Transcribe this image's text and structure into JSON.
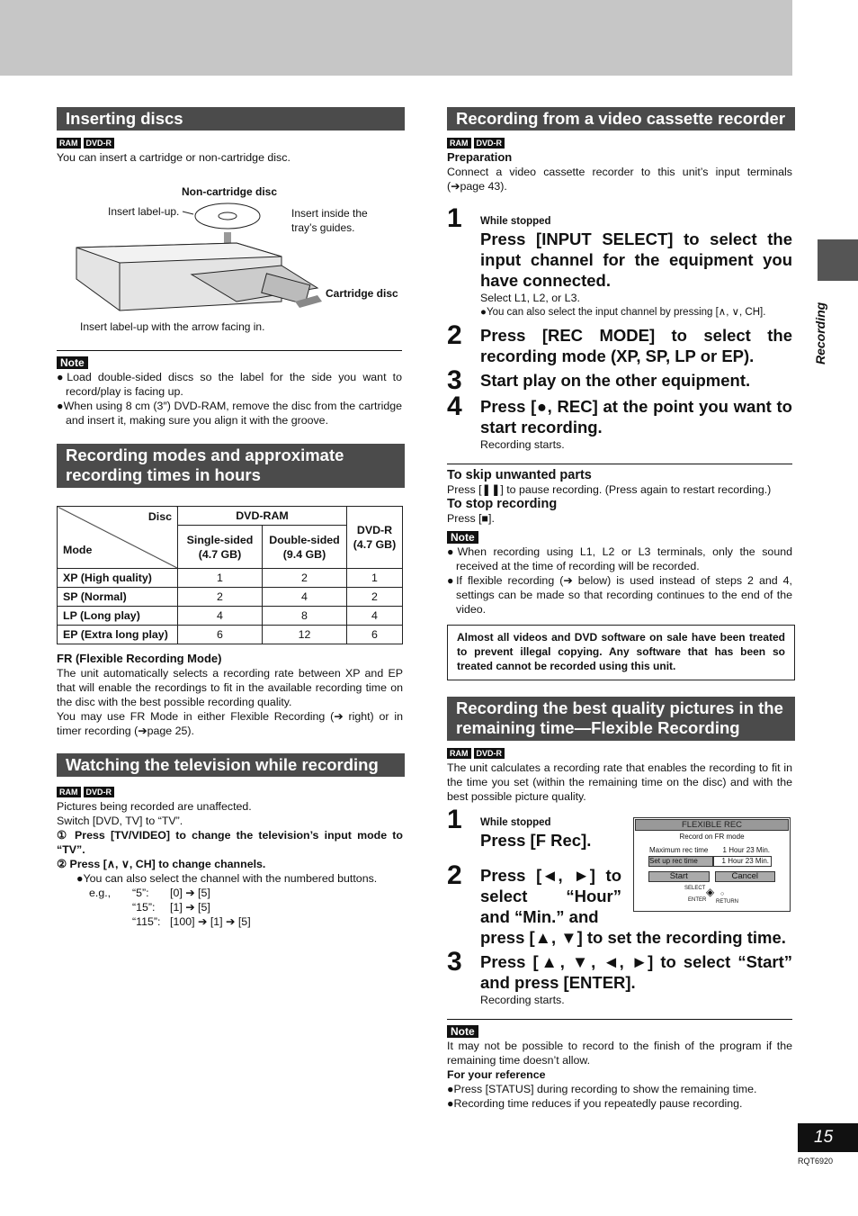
{
  "badges": {
    "ram": "RAM",
    "dvdr": "DVD-R"
  },
  "note_label": "Note",
  "inserting": {
    "title": "Inserting discs",
    "intro": "You can insert a cartridge or non-cartridge disc.",
    "fig": {
      "noncart": "Non-cartridge disc",
      "label_up": "Insert label-up.",
      "inside": "Insert inside the tray’s guides.",
      "cart": "Cartridge disc",
      "arrow": "Insert label-up with the arrow facing in."
    },
    "notes": [
      "Load double-sided discs so the label for the side you want to record/play is facing up.",
      "When using 8 cm (3″) DVD-RAM, remove the disc from the cartridge and insert it, making sure you align it with the groove."
    ]
  },
  "modes": {
    "title": "Recording modes and approximate recording times in hours",
    "table": {
      "disc": "Disc",
      "mode": "Mode",
      "dvdram": "DVD-RAM",
      "single": "Single-sided (4.7 GB)",
      "double": "Double-sided (9.4 GB)",
      "dvdr": "DVD-R (4.7 GB)",
      "rows": [
        {
          "m": "XP (High quality)",
          "a": "1",
          "b": "2",
          "c": "1"
        },
        {
          "m": "SP (Normal)",
          "a": "2",
          "b": "4",
          "c": "2"
        },
        {
          "m": "LP (Long play)",
          "a": "4",
          "b": "8",
          "c": "4"
        },
        {
          "m": "EP (Extra long play)",
          "a": "6",
          "b": "12",
          "c": "6"
        }
      ]
    },
    "fr_title": "FR (Flexible Recording Mode)",
    "fr_text": "The unit automatically selects a recording rate between XP and EP that will enable the recordings to fit in the available recording time on the disc with the best possible recording quality.",
    "fr_text2": "You may use FR Mode in either Flexible Recording (➔ right) or in timer recording (➔page 25)."
  },
  "watching": {
    "title": "Watching the television while recording",
    "l1": "Pictures being recorded are unaffected.",
    "l2": "Switch [DVD, TV] to “TV”.",
    "s1": "① Press [TV/VIDEO] to change the television’s input mode to “TV”.",
    "s2": "② Press [∧, ∨, CH] to change channels.",
    "b1": "You can also select the channel with the numbered buttons.",
    "eg": "e.g.,",
    "ex": [
      {
        "k": "“5”:",
        "v": "[0] ➔ [5]"
      },
      {
        "k": "“15”:",
        "v": "[1] ➔ [5]"
      },
      {
        "k": "“115”:",
        "v": "[100] ➔ [1] ➔ [5]"
      }
    ]
  },
  "vcr": {
    "title": "Recording from a video cassette recorder",
    "prep": "Preparation",
    "prep_text": "Connect a video cassette recorder to this unit’s input terminals (➔page 43).",
    "steps": [
      {
        "n": "1",
        "pre": "While stopped",
        "main": "Press [INPUT SELECT] to select the input channel for the equipment you have connected.",
        "sub": "Select L1, L2, or L3.",
        "bul": "You can also select the input channel by pressing [∧, ∨, CH]."
      },
      {
        "n": "2",
        "main": "Press [REC MODE] to select the recording mode (XP, SP, LP or EP)."
      },
      {
        "n": "3",
        "main": "Start play on the other equipment."
      },
      {
        "n": "4",
        "main": "Press [●, REC] at the point you want to start recording.",
        "sub": "Recording starts."
      }
    ],
    "skip_t": "To skip unwanted parts",
    "skip": "Press [❚❚] to pause recording. (Press again to restart recording.)",
    "stop_t": "To stop recording",
    "stop": "Press [■].",
    "notes": [
      "When recording using L1, L2 or L3 terminals, only the sound received at the time of recording will be recorded.",
      "If flexible recording (➔ below) is used instead of steps 2 and 4, settings can be made so that recording continues to the end of the video."
    ],
    "box": "Almost all videos and DVD software on sale have been treated to prevent illegal copying. Any software that has been so treated cannot be recorded using this unit."
  },
  "flex": {
    "title": "Recording the best quality pictures in the remaining time—Flexible Recording",
    "intro": "The unit calculates a recording rate that enables the recording to fit in the time you set (within the remaining time on the disc) and with the best possible picture quality.",
    "s1pre": "While stopped",
    "s1": "Press [F Rec].",
    "s2a": "Press [◄, ►] to select “Hour” and “Min.” and",
    "s2b": "press [▲, ▼] to set the recording time.",
    "s3": "Press [▲, ▼, ◄, ►] to select “Start” and press [ENTER].",
    "s3sub": "Recording starts.",
    "osd": {
      "title": "FLEXIBLE REC",
      "sub": "Record on FR mode",
      "max_l": "Maximum rec time",
      "max_v": "1 Hour 23 Min.",
      "set_l": "Set up rec time",
      "set_v": "1 Hour 23 Min.",
      "start": "Start",
      "cancel": "Cancel",
      "select": "SELECT",
      "enter": "ENTER",
      "return": "RETURN"
    },
    "note": "It may not be possible to record to the finish of the program if the remaining time doesn’t allow.",
    "ref_t": "For your reference",
    "refs": [
      "Press [STATUS] during recording to show the remaining time.",
      "Recording time reduces if you repeatedly pause recording."
    ]
  },
  "side_tab": "Recording",
  "page_number": "15",
  "doc_code": "RQT6920"
}
